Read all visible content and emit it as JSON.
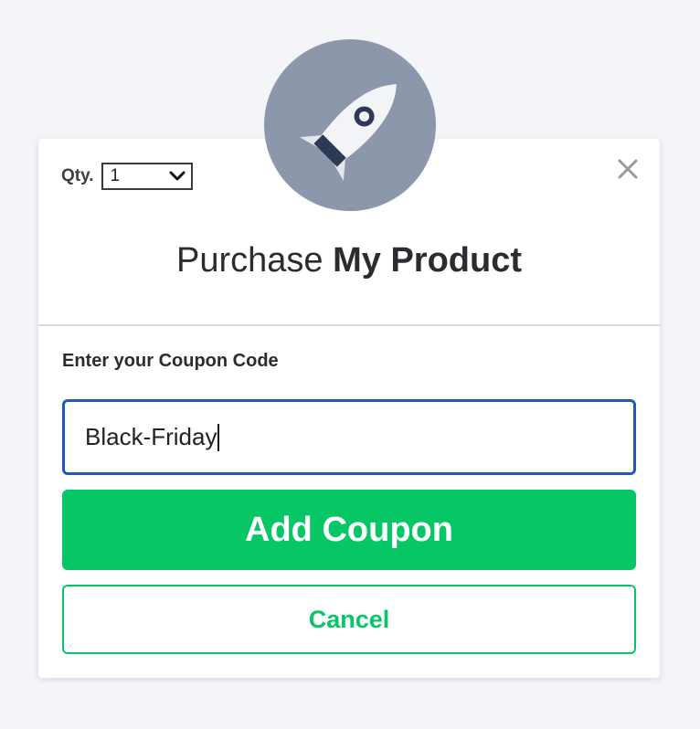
{
  "header": {
    "qty_label": "Qty.",
    "qty_value": "1",
    "title_prefix": "Purchase",
    "title_product": "My Product"
  },
  "coupon": {
    "label": "Enter your Coupon Code",
    "value": "Black-Friday"
  },
  "actions": {
    "add_label": "Add Coupon",
    "cancel_label": "Cancel"
  },
  "icons": {
    "logo": "rocket-icon",
    "close": "close-icon",
    "qty_dropdown": "chevron-down-icon"
  },
  "colors": {
    "accent_green": "#06c665",
    "input_focus_border": "#1d5bb8",
    "avatar_bg": "#8d97ab"
  }
}
